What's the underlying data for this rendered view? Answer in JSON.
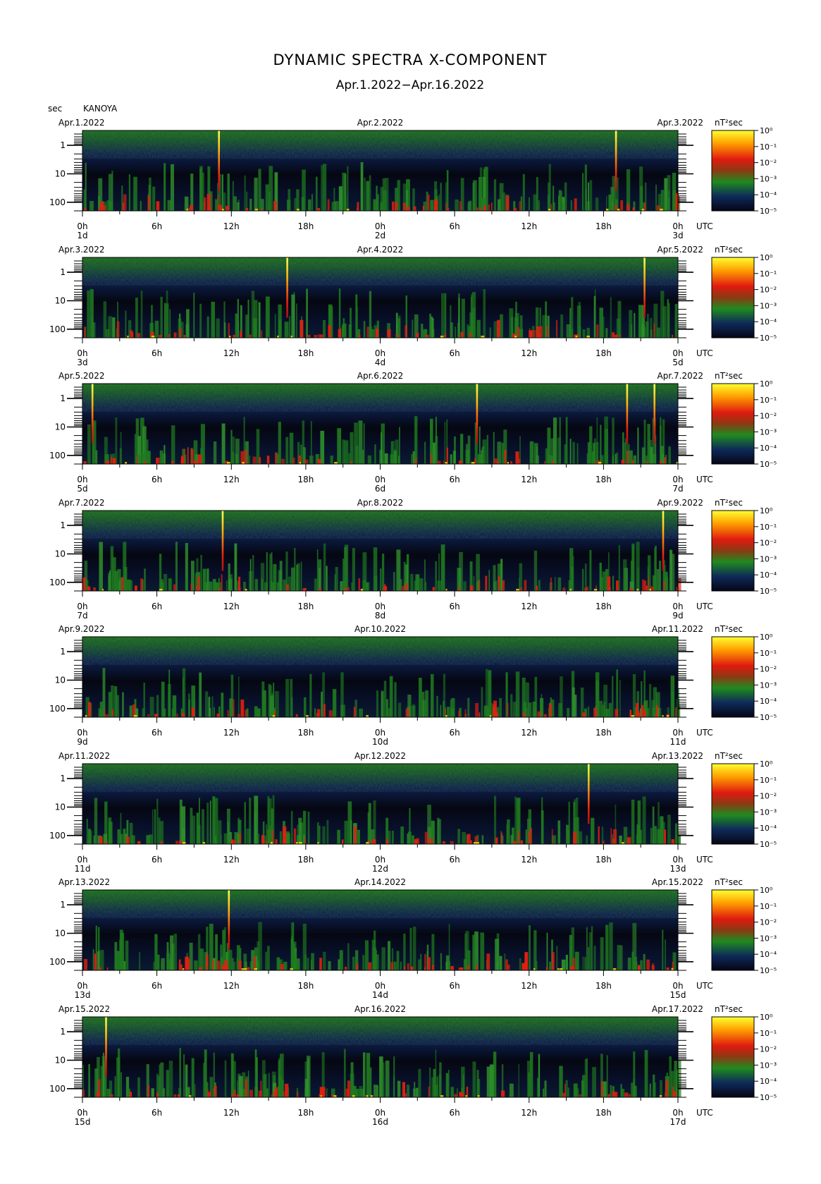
{
  "title": "DYNAMIC SPECTRA X-COMPONENT",
  "subtitle": "Apr.1.2022−Apr.16.2022",
  "y_axis_unit": "sec",
  "station": "KANOYA",
  "utc_label": "UTC",
  "colorbar_unit": "nT²sec",
  "colorbar_ticks": [
    "10⁰",
    "10⁻¹",
    "10⁻²",
    "10⁻³",
    "10⁻⁴",
    "10⁻⁵"
  ],
  "colors": {
    "low": "#0a0d2a",
    "mid": "#1f7a1f",
    "high": "#e02010",
    "peak": "#ffe000"
  },
  "chart_data": {
    "type": "heatmap",
    "title": "DYNAMIC SPECTRA X-COMPONENT",
    "subtitle": "Apr.1.2022−Apr.16.2022",
    "ylabel": "sec",
    "y_scale": "log",
    "y_ticks": [
      "1",
      "10",
      "100"
    ],
    "ylim": [
      200,
      0.3
    ],
    "x_ticks": [
      "0h",
      "6h",
      "12h",
      "18h",
      "0h",
      "6h",
      "12h",
      "18h",
      "0h"
    ],
    "colorbar": {
      "label": "nT²sec",
      "scale": "log",
      "range": [
        1e-05,
        1
      ]
    },
    "panels": [
      {
        "left_date": "Apr.1.2022",
        "center_date": "Apr.2.2022",
        "right_date": "Apr.3.2022",
        "day_labels": [
          "1d",
          "2d",
          "3d"
        ],
        "spikes_hours": [
          11,
          43
        ]
      },
      {
        "left_date": "Apr.3.2022",
        "center_date": "Apr.4.2022",
        "right_date": "Apr.5.2022",
        "day_labels": [
          "3d",
          "4d",
          "5d"
        ],
        "spikes_hours": [
          16.5,
          45.3
        ]
      },
      {
        "left_date": "Apr.5.2022",
        "center_date": "Apr.6.2022",
        "right_date": "Apr.7.2022",
        "day_labels": [
          "5d",
          "6d",
          "7d"
        ],
        "spikes_hours": [
          0.8,
          31.8,
          43.9,
          46.1
        ]
      },
      {
        "left_date": "Apr.7.2022",
        "center_date": "Apr.8.2022",
        "right_date": "Apr.9.2022",
        "day_labels": [
          "7d",
          "8d",
          "9d"
        ],
        "spikes_hours": [
          11.3,
          46.8
        ]
      },
      {
        "left_date": "Apr.9.2022",
        "center_date": "Apr.10.2022",
        "right_date": "Apr.11.2022",
        "day_labels": [
          "9d",
          "10d",
          "11d"
        ],
        "spikes_hours": []
      },
      {
        "left_date": "Apr.11.2022",
        "center_date": "Apr.12.2022",
        "right_date": "Apr.13.2022",
        "day_labels": [
          "11d",
          "12d",
          "13d"
        ],
        "spikes_hours": [
          40.8
        ]
      },
      {
        "left_date": "Apr.13.2022",
        "center_date": "Apr.14.2022",
        "right_date": "Apr.15.2022",
        "day_labels": [
          "13d",
          "14d",
          "15d"
        ],
        "spikes_hours": [
          11.8
        ]
      },
      {
        "left_date": "Apr.15.2022",
        "center_date": "Apr.16.2022",
        "right_date": "Apr.17.2022",
        "day_labels": [
          "15d",
          "16d",
          "17d"
        ],
        "spikes_hours": [
          1.9
        ]
      }
    ]
  }
}
